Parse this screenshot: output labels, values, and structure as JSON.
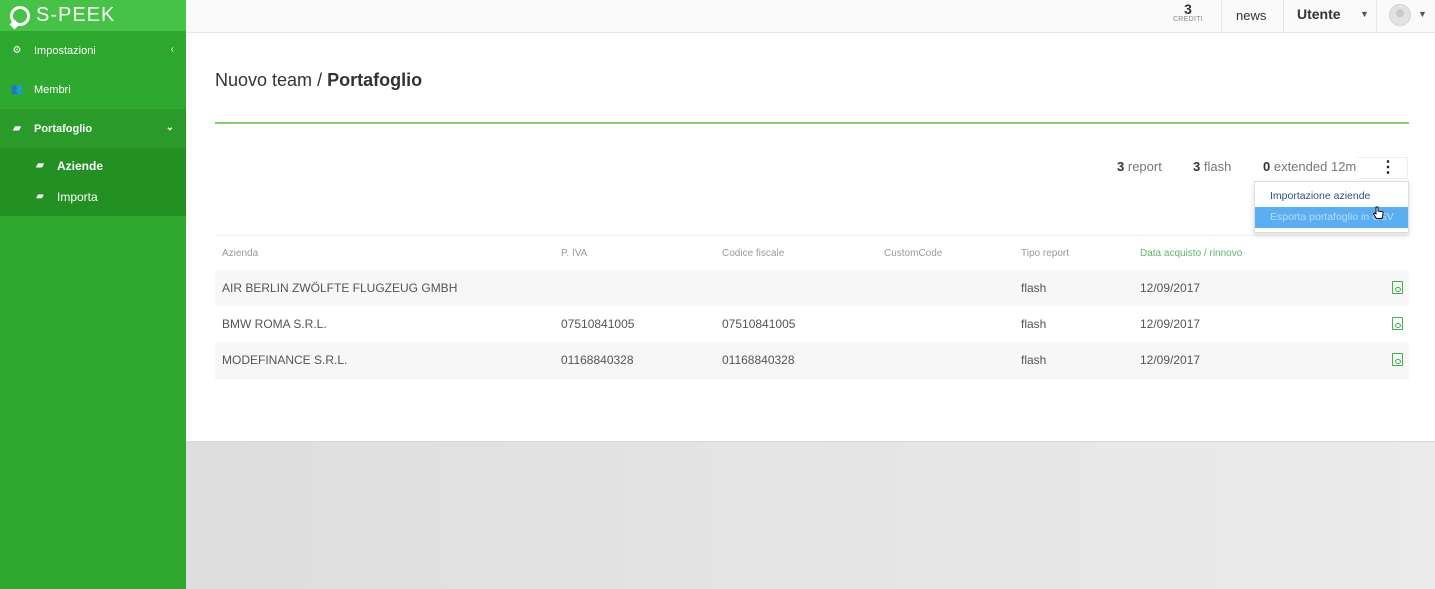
{
  "app": {
    "name": "S-PEEK"
  },
  "sidebar": {
    "items": [
      {
        "label": "Impostazioni",
        "icon": "gears-icon",
        "caret": "‹"
      },
      {
        "label": "Membri",
        "icon": "users-icon"
      },
      {
        "label": "Portafoglio",
        "icon": "book-icon",
        "caret": "⌄"
      }
    ],
    "subitems": [
      {
        "label": "Aziende",
        "icon": "book-icon"
      },
      {
        "label": "Importa",
        "icon": "book-icon"
      }
    ]
  },
  "topbar": {
    "credits_count": "3",
    "credits_label": "CREDITI",
    "news_label": "news",
    "user_label": "Utente"
  },
  "breadcrumb": {
    "parent": "Nuovo team",
    "separator": " / ",
    "current": "Portafoglio"
  },
  "stats": [
    {
      "count": "3",
      "label": "report"
    },
    {
      "count": "3",
      "label": "flash"
    },
    {
      "count": "0",
      "label": "extended 12m"
    }
  ],
  "menu": {
    "items": [
      {
        "label": "Importazione aziende"
      },
      {
        "label": "Esporta portafoglio in CSV"
      }
    ]
  },
  "table": {
    "headers": [
      "Azienda",
      "P. IVA",
      "Codice fiscale",
      "CustomCode",
      "Tipo report",
      "Data acquisto / rinnovo"
    ],
    "rows": [
      [
        "AIR BERLIN ZWÖLFTE FLUGZEUG GMBH",
        "",
        "",
        "",
        "flash",
        "12/09/2017"
      ],
      [
        "BMW ROMA S.R.L.",
        "07510841005",
        "07510841005",
        "",
        "flash",
        "12/09/2017"
      ],
      [
        "MODEFINANCE S.R.L.",
        "01168840328",
        "01168840328",
        "",
        "flash",
        "12/09/2017"
      ]
    ]
  },
  "colors": {
    "sidebar": "#2ea82e",
    "accent_rule": "#7fd36a",
    "link": "#2b4f86",
    "menu_hover": "#5aaef2",
    "header_text": "#999999"
  }
}
